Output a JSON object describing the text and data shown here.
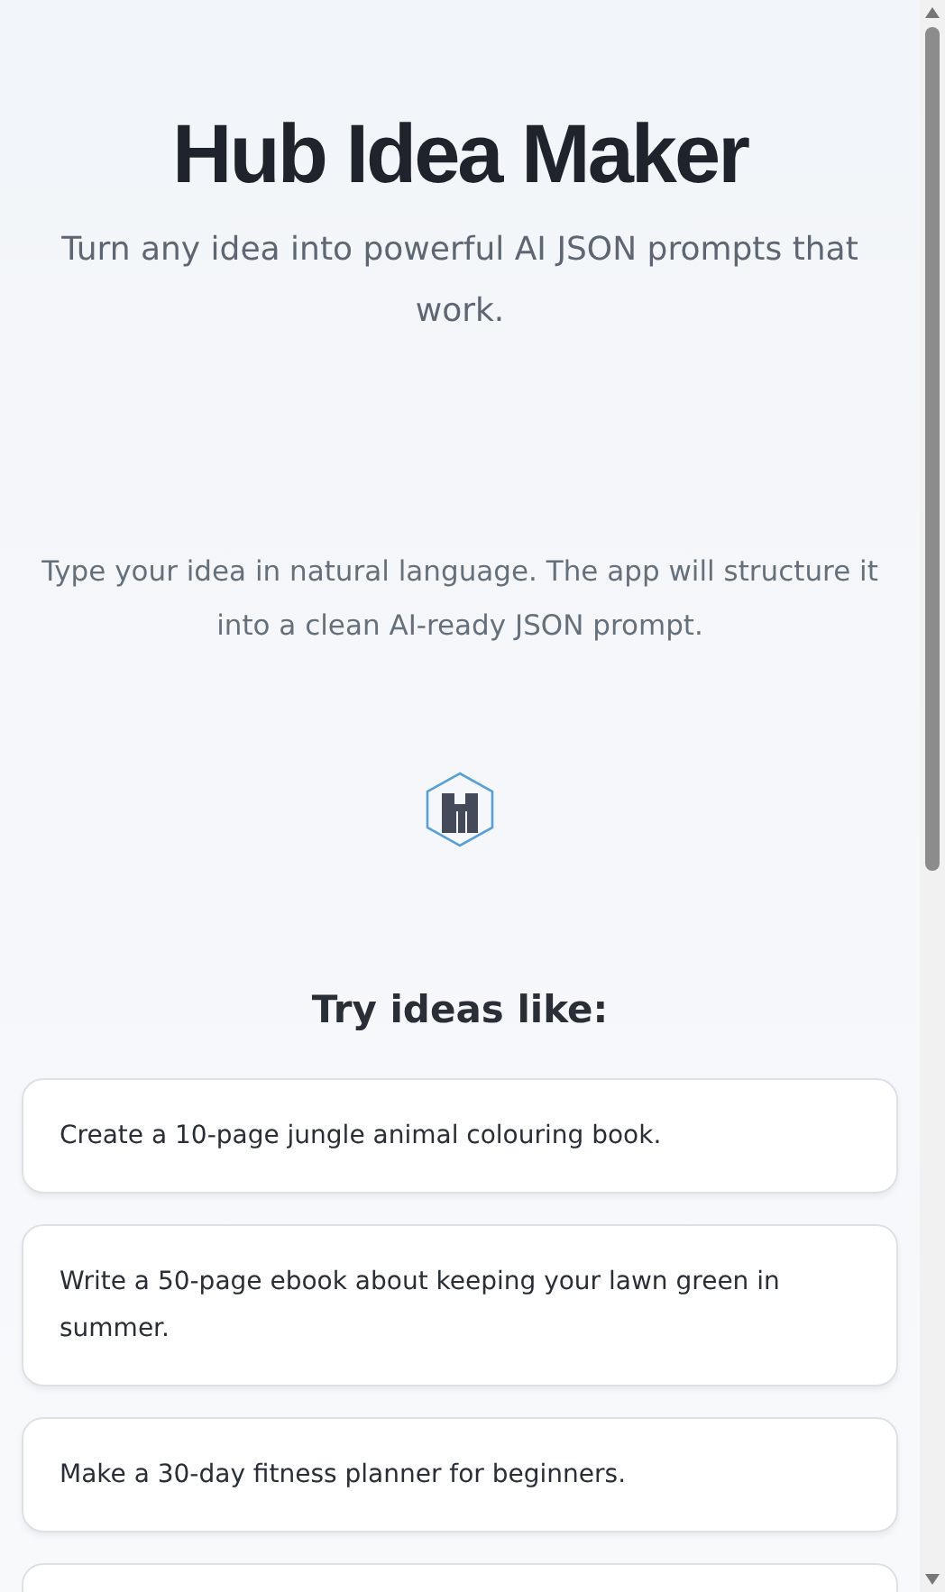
{
  "title": "Hub Idea Maker",
  "subtitle": "Turn any idea into powerful AI JSON prompts that work.",
  "description": "Type your idea in natural language. The app will structure it into a clean AI-ready JSON prompt.",
  "examples": {
    "heading": "Try ideas like:",
    "items": [
      "Create a 10-page jungle animal colouring book.",
      "Write a 50-page ebook about keeping your lawn green in summer.",
      "Make a 30-day fitness planner for beginners."
    ]
  }
}
